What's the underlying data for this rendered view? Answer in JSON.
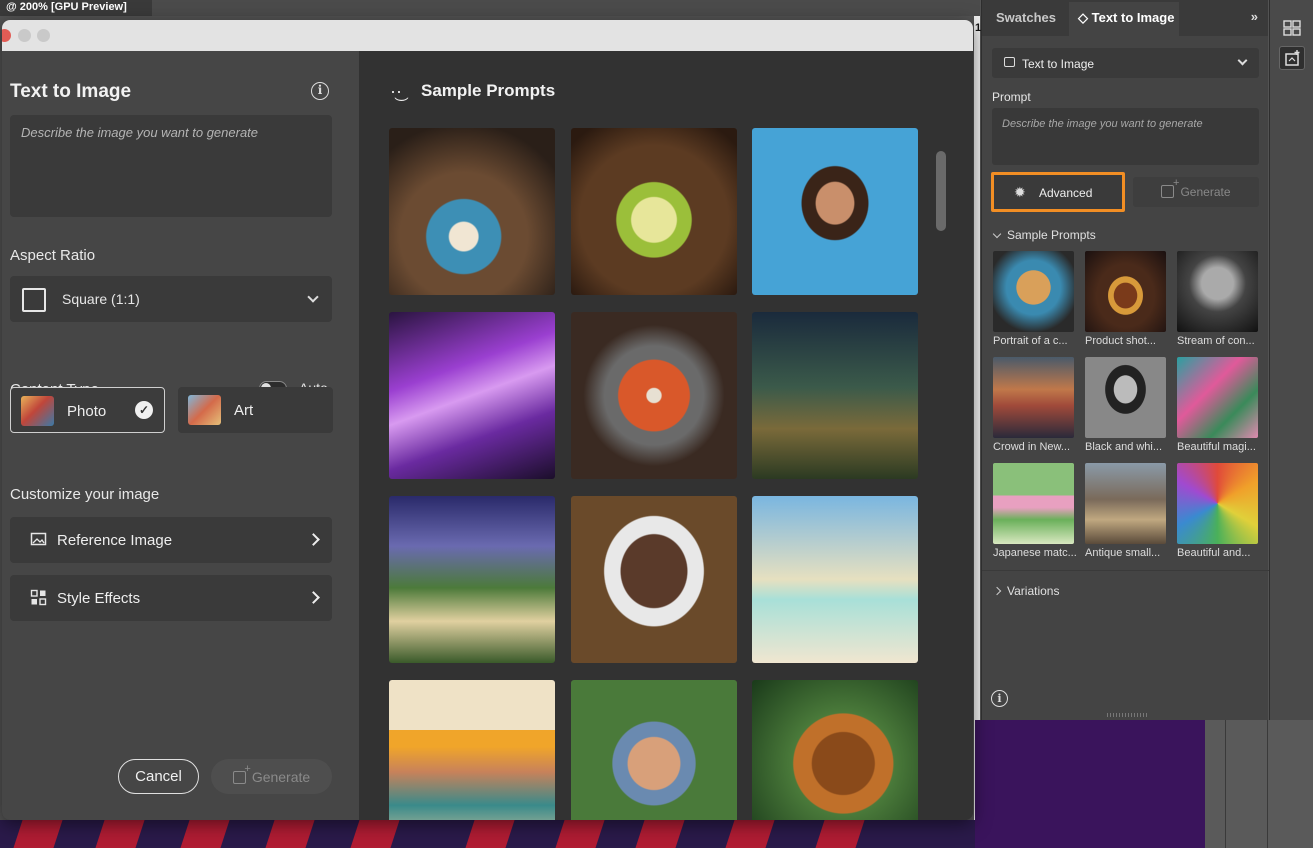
{
  "document": {
    "tab_title": "@ 200% [GPU Preview]",
    "ruler_mark": "1"
  },
  "dialog": {
    "title": "Text to Image",
    "prompt_placeholder": "Describe the image you want to generate",
    "aspect_ratio": {
      "label": "Aspect Ratio",
      "value": "Square (1:1)"
    },
    "content_type": {
      "label": "Content Type",
      "auto_label": "Auto",
      "auto_enabled": false,
      "options": [
        {
          "label": "Photo",
          "selected": true
        },
        {
          "label": "Art",
          "selected": false
        }
      ]
    },
    "customize": {
      "label": "Customize your image",
      "items": [
        {
          "label": "Reference Image"
        },
        {
          "label": "Style Effects"
        }
      ]
    },
    "cancel_label": "Cancel",
    "generate_label": "Generate",
    "sample_prompts": {
      "title": "Sample Prompts",
      "thumbnails": [
        "latte-art-coffee",
        "lime-cocktail",
        "cartoon-woman-glasses",
        "happy-birthday-balloons",
        "tomato-soup-bowl",
        "girl-in-forest-lantern",
        "fantasy-tree-lake",
        "elderly-man-beard",
        "beach-hut-palms",
        "sun-over-mountains-illustration",
        "woman-in-hat",
        "baby-orangutan"
      ]
    }
  },
  "panel": {
    "tabs": [
      {
        "label": "Swatches",
        "active": false
      },
      {
        "label": "Text to Image",
        "active": true
      }
    ],
    "tab_indicator": "◇",
    "collapse_label": "»",
    "mode_select": "Text to Image",
    "prompt_label": "Prompt",
    "prompt_placeholder": "Describe the image you want to generate",
    "advanced_label": "Advanced",
    "generate_label": "Generate",
    "sample_prompts_label": "Sample Prompts",
    "samples": [
      {
        "caption": "Portrait of a c...",
        "thumb": "kitten-sweater"
      },
      {
        "caption": "Product shot...",
        "thumb": "burger"
      },
      {
        "caption": "Stream of con...",
        "thumb": "bw-tree"
      },
      {
        "caption": "Crowd in New...",
        "thumb": "city-crowd"
      },
      {
        "caption": "Black and whi...",
        "thumb": "bw-woman"
      },
      {
        "caption": "Beautiful magi...",
        "thumb": "flamingos"
      },
      {
        "caption": "Japanese matc...",
        "thumb": "matcha-blossom"
      },
      {
        "caption": "Antique small...",
        "thumb": "antique-car"
      },
      {
        "caption": "Beautiful and...",
        "thumb": "paper-flower"
      }
    ],
    "variations_label": "Variations"
  },
  "colors": {
    "accent_highlight": "#f28e24",
    "dialog_bg": "#323232",
    "pane_bg": "#464646"
  }
}
